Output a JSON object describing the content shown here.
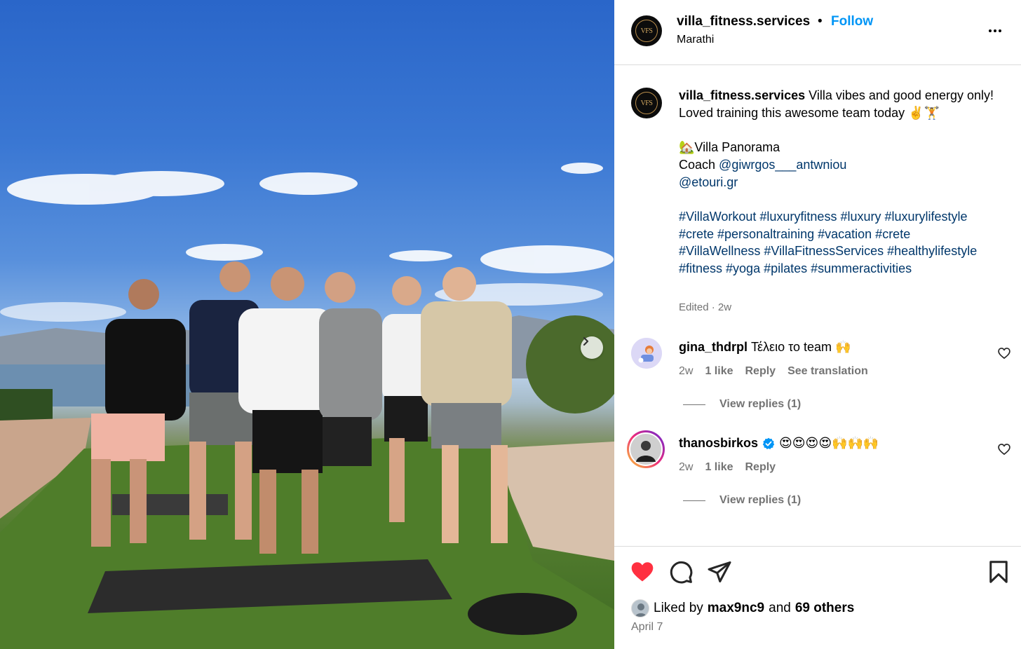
{
  "post": {
    "username": "villa_fitness.services",
    "avatar_text": "VFS",
    "separator": "•",
    "follow_label": "Follow",
    "location": "Marathi",
    "more_icon": "more-horizontal-icon",
    "next_icon": "chevron-right-icon"
  },
  "caption": {
    "username": "villa_fitness.services",
    "line1": "Villa vibes and good energy only!",
    "line2": "Loved training this awesome team today ✌️🏋️",
    "place": "🏡Villa Panorama",
    "coach_prefix": "Coach ",
    "mention1": "@giwrgos___antwniou",
    "mention2": "@etouri.gr",
    "hashtags_line1": "#VillaWorkout #luxuryfitness #luxury #luxurylifestyle",
    "hashtags_line2": "#crete #personaltraining #vacation #crete",
    "hashtags_line3": "#VillaWellness #VillaFitnessServices #healthylifestyle",
    "hashtags_line4": "#fitness #yoga #pilates #summeractivities",
    "meta": "Edited · 2w"
  },
  "comments": [
    {
      "username": "gina_thdrpl",
      "text": "Τέλειο το team 🙌",
      "time": "2w",
      "likes": "1 like",
      "reply": "Reply",
      "translate": "See translation",
      "view_replies": "View replies (1)"
    },
    {
      "username": "thanosbirkos",
      "verified_icon": "verified-badge-icon",
      "text": "😍😍😍😍🙌🙌🙌",
      "time": "2w",
      "likes": "1 like",
      "reply": "Reply",
      "view_replies": "View replies (1)"
    }
  ],
  "actions": {
    "like_icon": "heart-filled-icon",
    "comment_icon": "comment-icon",
    "share_icon": "share-icon",
    "save_icon": "bookmark-icon",
    "like_color": "#ff3040"
  },
  "likes": {
    "prefix": "Liked by",
    "user": "max9nc9",
    "and": "and",
    "others": "69 others"
  },
  "date": "April 7",
  "colors": {
    "follow": "#0095f6",
    "link": "#00376b",
    "muted": "#737373",
    "verified": "#0095f6"
  }
}
